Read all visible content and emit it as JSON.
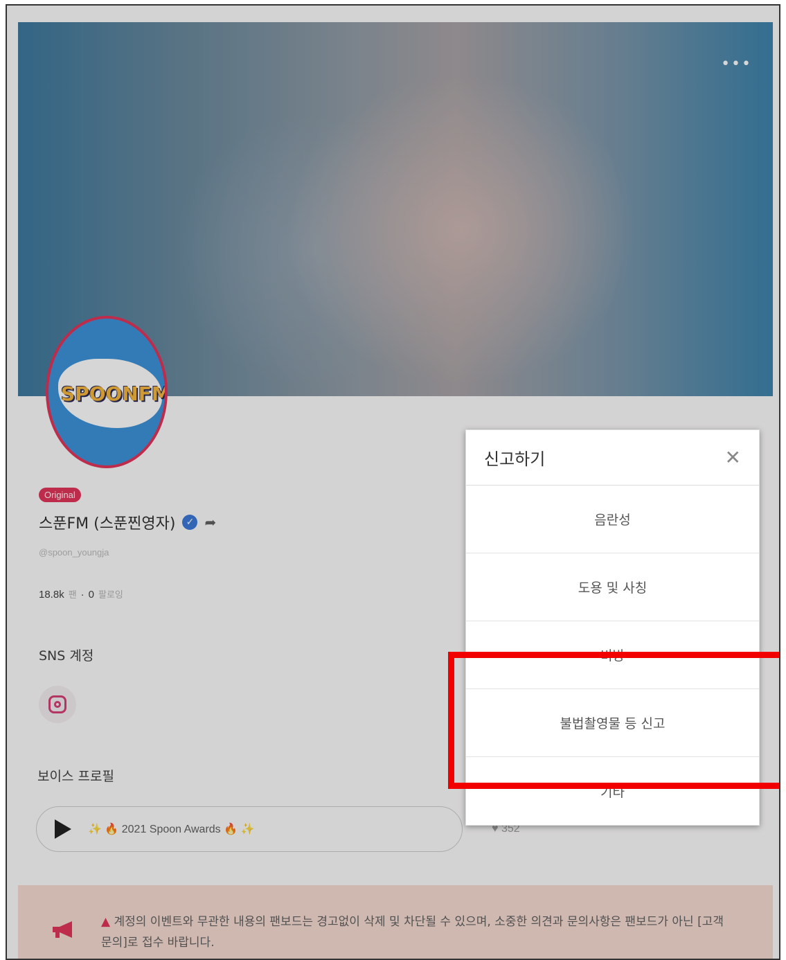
{
  "header": {
    "more_label": "•••"
  },
  "profile": {
    "avatar_text": "SPOONFM",
    "badge": "Original",
    "name": "스푼FM (스푼찐영자)",
    "handle": "@spoon_youngja",
    "fans_count": "18.8k",
    "fans_label": "팬",
    "separator": "·",
    "following_count": "0",
    "following_label": "팔로잉"
  },
  "sns": {
    "title": "SNS 계정",
    "icon": "instagram-icon"
  },
  "voice": {
    "title": "보이스 프로필",
    "sparkle": "✨",
    "fire": "🔥",
    "track": "2021 Spoon Awards",
    "heart_count": "352"
  },
  "notice": {
    "warn_icon": "▲",
    "text": "계정의 이벤트와 무관한 내용의 팬보드는 경고없이 삭제 및 차단될 수 있으며, 소중한 의견과 문의사항은 팬보드가 아닌 [고객문의]로 접수 바랍니다."
  },
  "report_modal": {
    "title": "신고하기",
    "close": "✕",
    "options": [
      {
        "label": "음란성"
      },
      {
        "label": "도용 및 사칭"
      },
      {
        "label": "비방"
      },
      {
        "label": "불법촬영물 등 신고"
      },
      {
        "label": "기타"
      }
    ]
  },
  "colors": {
    "accent": "#e0264f",
    "highlight": "#f20000",
    "verified": "#2f6fd6"
  }
}
